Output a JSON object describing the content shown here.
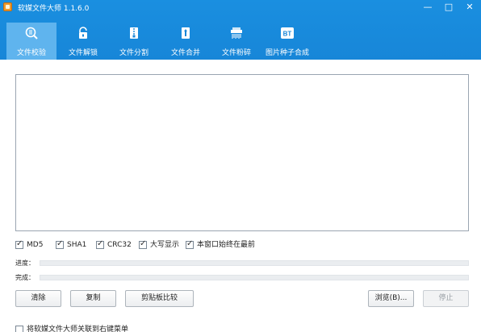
{
  "window": {
    "title": "软媒文件大师 1.1.6.0",
    "controls": {
      "minimize": "—",
      "maximize": "□",
      "close": "✕"
    }
  },
  "toolbar": {
    "items": [
      {
        "label": "文件校验",
        "icon": "magnifier-hash-icon",
        "active": true
      },
      {
        "label": "文件解锁",
        "icon": "unlock-icon",
        "active": false
      },
      {
        "label": "文件分割",
        "icon": "zip-split-icon",
        "active": false
      },
      {
        "label": "文件合并",
        "icon": "zip-merge-icon",
        "active": false
      },
      {
        "label": "文件粉碎",
        "icon": "shredder-icon",
        "active": false
      },
      {
        "label": "图片种子合成",
        "icon": "bt-icon",
        "active": false
      }
    ],
    "bt_text": "BT"
  },
  "options": [
    {
      "label": "MD5",
      "checked": true
    },
    {
      "label": "SHA1",
      "checked": true
    },
    {
      "label": "CRC32",
      "checked": true
    },
    {
      "label": "大写显示",
      "checked": true
    },
    {
      "label": "本窗口始终在最前",
      "checked": true
    }
  ],
  "progress": {
    "label": "进度：",
    "value": 0
  },
  "complete": {
    "label": "完成：",
    "value": 0
  },
  "buttons": {
    "clear": "清除",
    "copy": "复制",
    "clipboard_compare": "剪贴板比较",
    "browse": "浏览(B)...",
    "stop": "停止"
  },
  "context_menu_option": {
    "label": "将软媒文件大师关联到右键菜单",
    "checked": false
  },
  "colors": {
    "header": "#1786d8",
    "active_tab": "#5fb4ee",
    "progress_fill": "#4a9be0"
  }
}
